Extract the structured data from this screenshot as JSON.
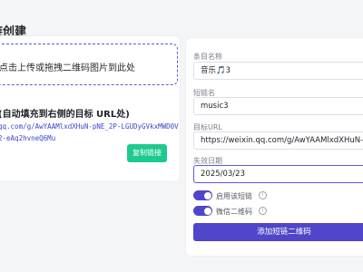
{
  "page": {
    "title": "链创建"
  },
  "upload": {
    "hint": "点击上传或拖拽二维码图片到此处"
  },
  "parsed": {
    "title": "(自动填充到右侧的目标 URL处)",
    "url_line1": "qq.com/g/AwYAAMlxdXHuN-pNE_2P-LGUDyGVkxMWD0V",
    "url_line2": "2-eAq2hvneQ6Mu",
    "copy_label": "复制链接"
  },
  "form": {
    "name_label": "条目名称",
    "name_value": "音乐🎵3",
    "short_label": "短链名",
    "short_value": "music3",
    "target_label": "目标URL",
    "target_value": "https://weixin.qq.com/g/AwYAAMlxdXHuN-pNE_2P-LGUD",
    "expire_label": "失效日期",
    "expire_value": "2025/03/23",
    "toggle_short_label": "启用该短链",
    "toggle_qr_label": "微信二维码",
    "submit_label": "添加短链二维码"
  },
  "colors": {
    "accent": "#4f46c9",
    "success": "#1ec98f",
    "link": "#3b46c8"
  }
}
